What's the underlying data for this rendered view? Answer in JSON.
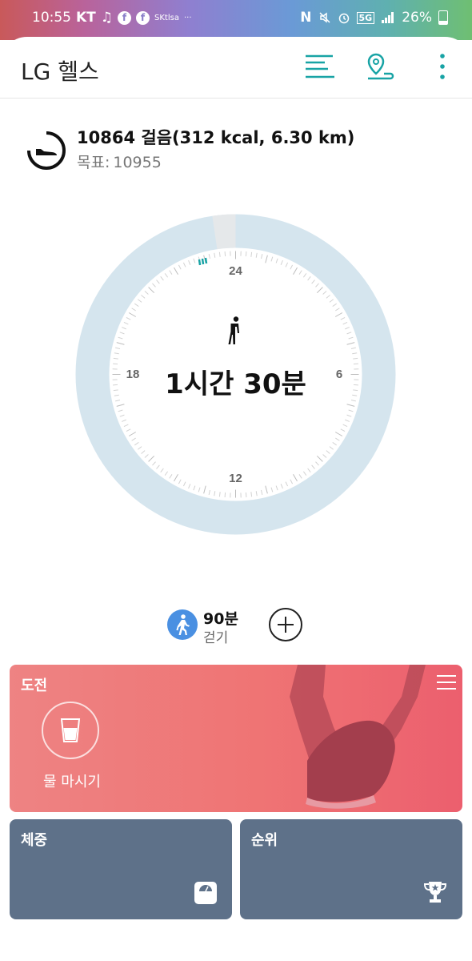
{
  "status_bar": {
    "time": "10:55",
    "carrier": "KT",
    "small_label": "SKtlsa",
    "more": "···",
    "network": "5G",
    "battery": "26%"
  },
  "app": {
    "title": "LG 헬스"
  },
  "steps": {
    "summary": "10864 걸음(312 kcal, 6.30 km)",
    "goal_label": "목표:",
    "goal_value": "10955",
    "progress_fraction": 0.9917
  },
  "dial": {
    "labels": {
      "top": "24",
      "right": "6",
      "bottom": "12",
      "left": "18"
    },
    "duration": "1시간 30분"
  },
  "activity": {
    "minutes": "90분",
    "name": "걷기"
  },
  "cards": {
    "challenge": {
      "title": "도전",
      "item_label": "물 마시기"
    },
    "weight": {
      "title": "체중"
    },
    "rank": {
      "title": "순위"
    }
  },
  "colors": {
    "ring": "#d5e5ee",
    "ring_gap": "#e5e8ea",
    "teal_accent": "#18a3a5",
    "challenge_card": "#ef7474",
    "tile": "#5e7189",
    "activity_blue": "#4a90e2"
  },
  "icons": {
    "app_bar": [
      "list-icon",
      "location-pin-icon",
      "more-vert-icon"
    ],
    "steps": "shoe-gauge-icon",
    "dial_center": "walking-person-icon",
    "challenge": "water-glass-icon",
    "weight": "scale-icon",
    "rank": "trophy-icon"
  }
}
